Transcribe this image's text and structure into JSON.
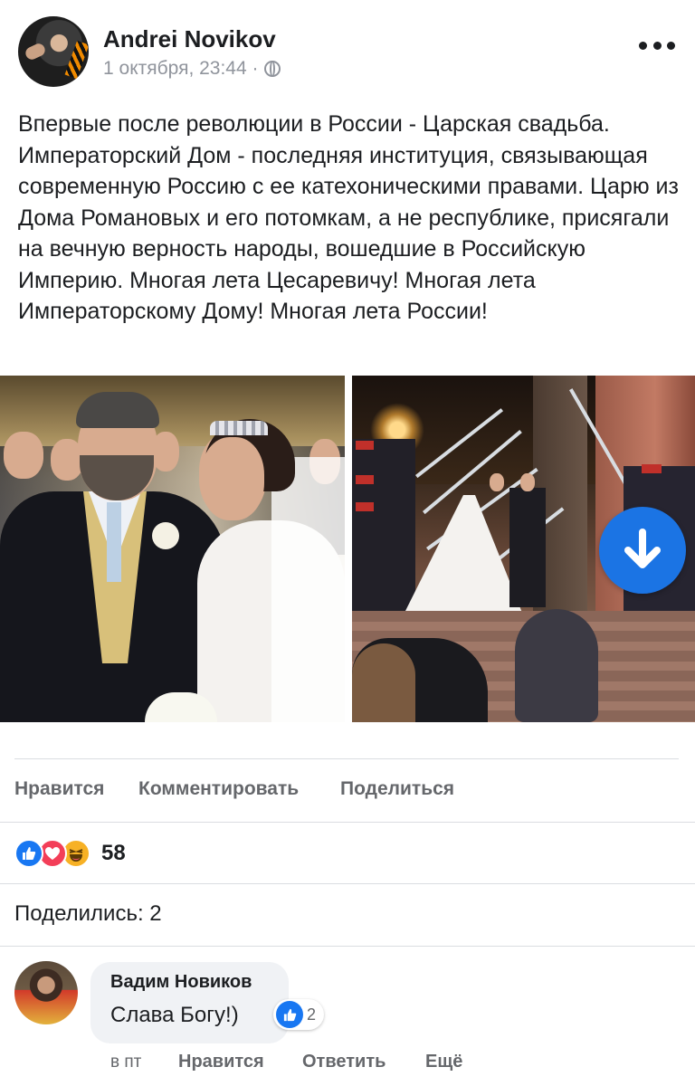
{
  "post": {
    "author": "Andrei Novikov",
    "timestamp": "1 октября, 23:44 ·",
    "privacy_icon": "globe-icon",
    "text": "Впервые после революции в России - Царская свадьба. Императорский Дом - последняя институция, связывающая современную Россию с ее катехоническими правами. Царю из Дома Романовых и его потомкам, а не республике, присягали на вечную верность народы, вошедшие в Российскую Империю. Многая лета Цесаревичу! Многая лета Императорскому Дому! Многая лета России!"
  },
  "actions": {
    "like": "Нравится",
    "comment": "Комментировать",
    "share": "Поделиться"
  },
  "reactions": {
    "icons": [
      "like-icon",
      "love-icon",
      "haha-icon"
    ],
    "count": "58"
  },
  "shares": "Поделились: 2",
  "comment": {
    "author": "Вадим Новиков",
    "text": "Слава Богу!)",
    "reaction_count": "2",
    "time": "в пт",
    "like": "Нравится",
    "reply": "Ответить",
    "more": "Ещё"
  },
  "colors": {
    "accent": "#1b74e4",
    "like": "#1877f2",
    "love": "#f33e58",
    "haha": "#f7b125",
    "muted": "#65676b"
  }
}
